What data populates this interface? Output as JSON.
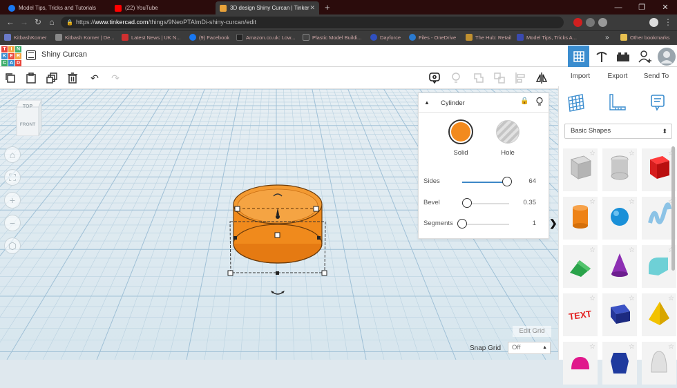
{
  "browser": {
    "tabs": [
      {
        "label": "Model Tips, Tricks and Tutorials",
        "favicon_color": "#1877f2",
        "active": false
      },
      {
        "label": "(22) YouTube",
        "favicon_color": "#ff0000",
        "active": false
      },
      {
        "label": "3D design Shiny Curcan | Tinker…",
        "favicon_color": "#e8a23a",
        "active": true
      }
    ],
    "new_tab_label": "+",
    "window_controls": [
      "—",
      "❐",
      "✕"
    ],
    "url_host": "www.tinkercad.com",
    "url_prefix": "https://",
    "url_path": "/things/9NeoPTAlmDi-shiny-curcan/edit",
    "bookmarks": [
      {
        "label": "KitbashKorner",
        "color": "#6a7ac8"
      },
      {
        "label": "Kitbash Korner | De...",
        "color": "#888888"
      },
      {
        "label": "Latest News | UK N...",
        "color": "#d03030"
      },
      {
        "label": "(9) Facebook",
        "color": "#1877f2"
      },
      {
        "label": "Amazon.co.uk: Low...",
        "color": "#222222"
      },
      {
        "label": "Plastic Model Buildi...",
        "color": "#444444"
      },
      {
        "label": "Dayforce",
        "color": "#3050c0"
      },
      {
        "label": "Files - OneDrive",
        "color": "#2a7ad0"
      },
      {
        "label": "The Hub: Retail",
        "color": "#c09030"
      },
      {
        "label": "Model Tips, Tricks A...",
        "color": "#3a4ab0"
      }
    ],
    "bookmarks_more": "»",
    "other_bookmarks": "Other bookmarks"
  },
  "app": {
    "logo_letters": [
      "T",
      "I",
      "N",
      "K",
      "E",
      "R",
      "C",
      "A",
      "D"
    ],
    "design_title": "Shiny Curcan"
  },
  "toolbar": {
    "import_label": "Import",
    "export_label": "Export",
    "send_to_label": "Send To"
  },
  "viewcube": {
    "top_label": "TOP",
    "front_label": "FRONT"
  },
  "inspector": {
    "shape_name": "Cylinder",
    "solid_label": "Solid",
    "hole_label": "Hole",
    "solid_color": "#f28a1e",
    "props": [
      {
        "label": "Sides",
        "value": "64",
        "fraction": 0.95
      },
      {
        "label": "Bevel",
        "value": "0.35",
        "fraction": 0.1
      },
      {
        "label": "Segments",
        "value": "1",
        "fraction": 0.0
      }
    ]
  },
  "library": {
    "category": "Basic Shapes",
    "shapes": [
      {
        "name": "box-hole"
      },
      {
        "name": "cylinder-hole"
      },
      {
        "name": "box"
      },
      {
        "name": "cylinder"
      },
      {
        "name": "sphere"
      },
      {
        "name": "scribble"
      },
      {
        "name": "roof"
      },
      {
        "name": "cone"
      },
      {
        "name": "round-roof"
      },
      {
        "name": "text"
      },
      {
        "name": "shape-generator"
      },
      {
        "name": "pyramid"
      },
      {
        "name": "half-sphere"
      },
      {
        "name": "polygon"
      },
      {
        "name": "paraboloid"
      }
    ]
  },
  "workplane": {
    "edit_grid_label": "Edit Grid",
    "snap_grid_label": "Snap Grid",
    "snap_grid_value": "Off"
  }
}
